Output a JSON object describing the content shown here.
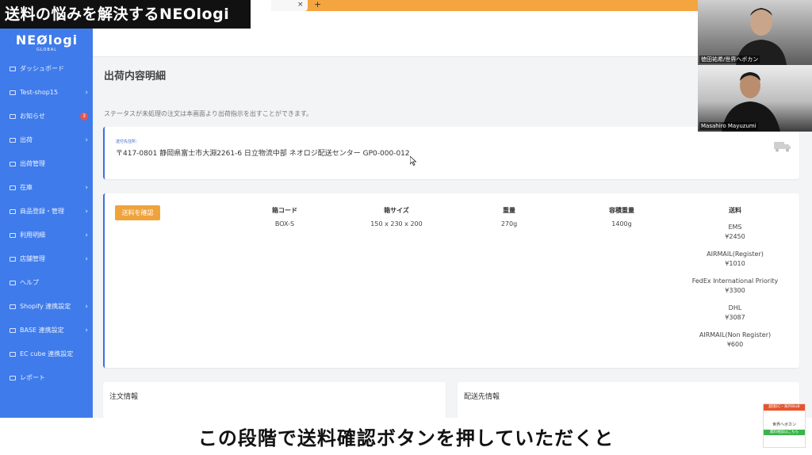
{
  "video": {
    "title": "送料の悩みを解決するNEOlogi",
    "subtitle": "この段階で送料確認ボタンを押していただくと"
  },
  "browser": {
    "tab_close": "×",
    "tab_add": "+"
  },
  "brand": {
    "logo": "NEØlogi",
    "logo_sub": "GLOBAL"
  },
  "sidebar": {
    "items": [
      {
        "label": "ダッシュボード",
        "chevron": ""
      },
      {
        "label": "Test-shop15",
        "chevron": "›"
      },
      {
        "label": "お知らせ",
        "badge": "3"
      },
      {
        "label": "出荷",
        "chevron": "›"
      },
      {
        "label": "出荷管理",
        "chevron": ""
      },
      {
        "label": "在庫",
        "chevron": "›"
      },
      {
        "label": "商品登録・管理",
        "chevron": "›"
      },
      {
        "label": "利用明細",
        "chevron": "›"
      },
      {
        "label": "店舗管理",
        "chevron": "›"
      },
      {
        "label": "ヘルプ",
        "chevron": ""
      },
      {
        "label": "Shopify 連携設定",
        "chevron": "›"
      },
      {
        "label": "BASE 連携設定",
        "chevron": "›"
      },
      {
        "label": "EC cube 連携設定",
        "chevron": ""
      },
      {
        "label": "レポート",
        "chevron": ""
      }
    ]
  },
  "page": {
    "title": "出荷内容明細",
    "hint": "ステータスが未処理の注文は本画面より出荷指示を出すことができます。"
  },
  "shipping_from": {
    "label": "送付先住所：",
    "address": "〒417-0801 静岡県富士市大淵2261-6 日立物流中部 ネオロジ配送センター GP0-000-012"
  },
  "box": {
    "confirm_button": "送料を確認",
    "headers": {
      "code": "箱コード",
      "size": "箱サイズ",
      "weight": "重量",
      "vol_weight": "容積重量",
      "rate": "送料"
    },
    "values": {
      "code": "BOX-S",
      "size": "150 x 230 x 200",
      "weight": "270g",
      "vol_weight": "1400g"
    },
    "rates": [
      {
        "carrier": "EMS",
        "price": "¥2450"
      },
      {
        "carrier": "AIRMAIL(Register)",
        "price": "¥1010"
      },
      {
        "carrier": "FedEx International Priority",
        "price": "¥3300"
      },
      {
        "carrier": "DHL",
        "price": "¥3087"
      },
      {
        "carrier": "AIRMAIL(Non Register)",
        "price": "¥600"
      }
    ]
  },
  "order_info": {
    "title": "注文情報"
  },
  "dest_info": {
    "title": "配送先情報"
  },
  "webcams": [
    {
      "name": "徳田祐希/世界へボカン"
    },
    {
      "name": "Masahiro Mayuzumi"
    }
  ],
  "promo": {
    "top": "越境EC・海外BtoB",
    "mid": "世界へボカン",
    "bottom": "無料相談はこちら"
  },
  "colors": {
    "sidebar": "#3f7bea",
    "accent_button": "#f0a33b",
    "card_border": "#3f6fe0",
    "browser_bar": "#f4a540"
  }
}
